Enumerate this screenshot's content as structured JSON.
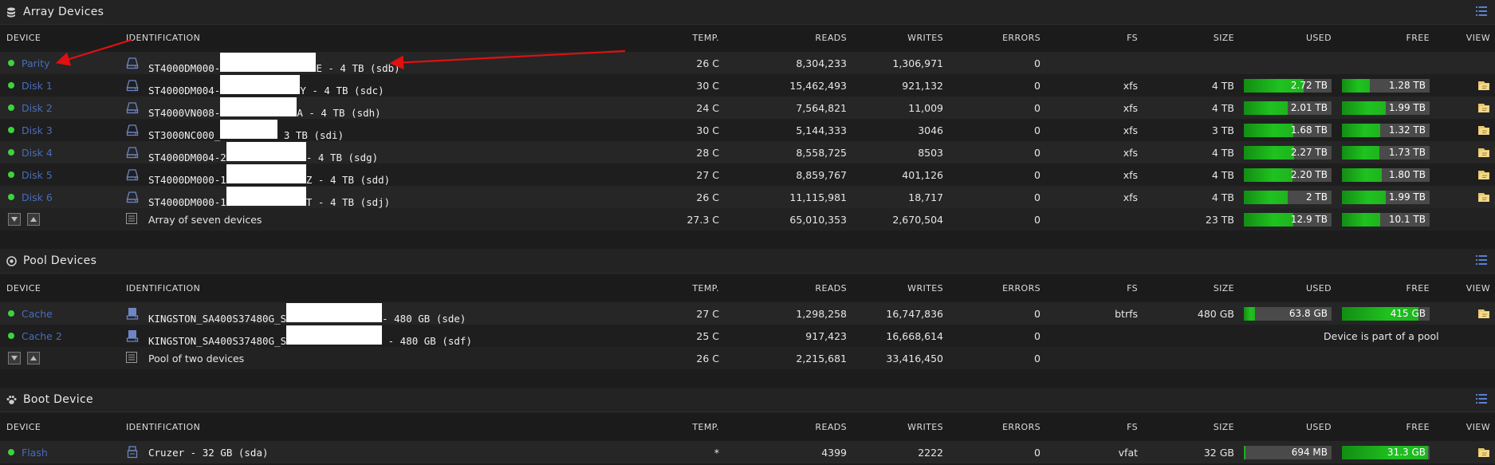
{
  "columns": {
    "device": "DEVICE",
    "identification": "IDENTIFICATION",
    "temp": "TEMP.",
    "reads": "READS",
    "writes": "WRITES",
    "errors": "ERRORS",
    "fs": "FS",
    "size": "SIZE",
    "used": "USED",
    "free": "FREE",
    "view": "VIEW"
  },
  "colors": {
    "status_ok": "#3cd33c",
    "device_link": "#486dba",
    "bar_fill": "#1fc21f",
    "bar_bg": "#4a4a4a",
    "annotation_arrow": "#e01010"
  },
  "sections": {
    "array": {
      "title": "Array Devices",
      "icon": "database-icon",
      "rows": [
        {
          "device": "Parity",
          "id_pre": "ST4000DM000-",
          "id_post": "E - 4 TB (sdb)",
          "temp": "26 C",
          "reads": "8,304,233",
          "writes": "1,306,971",
          "errors": "0",
          "fs": "",
          "size": "",
          "used": "",
          "free": "",
          "used_frac": 0,
          "free_frac": 0
        },
        {
          "device": "Disk 1",
          "id_pre": "ST4000DM004-",
          "id_post": "Y - 4 TB (sdc)",
          "temp": "30 C",
          "reads": "15,462,493",
          "writes": "921,132",
          "errors": "0",
          "fs": "xfs",
          "size": "4 TB",
          "used": "2.72 TB",
          "free": "1.28 TB",
          "used_frac": 0.68,
          "free_frac": 0.32
        },
        {
          "device": "Disk 2",
          "id_pre": "ST4000VN008-",
          "id_post": "A - 4 TB (sdh)",
          "temp": "24 C",
          "reads": "7,564,821",
          "writes": "11,009",
          "errors": "0",
          "fs": "xfs",
          "size": "4 TB",
          "used": "2.01 TB",
          "free": "1.99 TB",
          "used_frac": 0.5,
          "free_frac": 0.5
        },
        {
          "device": "Disk 3",
          "id_pre": "ST3000NC000_",
          "id_post": " 3 TB (sdi)",
          "temp": "30 C",
          "reads": "5,144,333",
          "writes": "3046",
          "errors": "0",
          "fs": "xfs",
          "size": "3 TB",
          "used": "1.68 TB",
          "free": "1.32 TB",
          "used_frac": 0.56,
          "free_frac": 0.44
        },
        {
          "device": "Disk 4",
          "id_pre": "ST4000DM004-2",
          "id_post": "- 4 TB (sdg)",
          "temp": "28 C",
          "reads": "8,558,725",
          "writes": "8503",
          "errors": "0",
          "fs": "xfs",
          "size": "4 TB",
          "used": "2.27 TB",
          "free": "1.73 TB",
          "used_frac": 0.57,
          "free_frac": 0.43
        },
        {
          "device": "Disk 5",
          "id_pre": "ST4000DM000-1",
          "id_post": "Z - 4 TB (sdd)",
          "temp": "27 C",
          "reads": "8,859,767",
          "writes": "401,126",
          "errors": "0",
          "fs": "xfs",
          "size": "4 TB",
          "used": "2.20 TB",
          "free": "1.80 TB",
          "used_frac": 0.55,
          "free_frac": 0.45
        },
        {
          "device": "Disk 6",
          "id_pre": "ST4000DM000-1",
          "id_post": "T - 4 TB (sdj)",
          "temp": "26 C",
          "reads": "11,115,981",
          "writes": "18,717",
          "errors": "0",
          "fs": "xfs",
          "size": "4 TB",
          "used": "2 TB",
          "free": "1.99 TB",
          "used_frac": 0.5,
          "free_frac": 0.5
        }
      ],
      "total": {
        "label": "Array of seven devices",
        "temp": "27.3 C",
        "reads": "65,010,353",
        "writes": "2,670,504",
        "errors": "0",
        "size": "23 TB",
        "used": "12.9 TB",
        "free": "10.1 TB",
        "used_frac": 0.56,
        "free_frac": 0.44
      }
    },
    "pool": {
      "title": "Pool Devices",
      "icon": "disc-icon",
      "rows": [
        {
          "device": "Cache",
          "id_pre": "KINGSTON_SA400S37480G_S",
          "id_post": "- 480 GB (sde)",
          "temp": "27 C",
          "reads": "1,298,258",
          "writes": "16,747,836",
          "errors": "0",
          "fs": "btrfs",
          "size": "480 GB",
          "used": "63.8 GB",
          "free": "415 GB",
          "used_frac": 0.13,
          "free_frac": 0.87
        },
        {
          "device": "Cache 2",
          "id_pre": "KINGSTON_SA400S37480G_S",
          "id_post": " - 480 GB (sdf)",
          "temp": "25 C",
          "reads": "917,423",
          "writes": "16,668,614",
          "errors": "0",
          "note": "Device is part of a pool"
        }
      ],
      "total": {
        "label": "Pool of two devices",
        "temp": "26 C",
        "reads": "2,215,681",
        "writes": "33,416,450",
        "errors": "0"
      }
    },
    "boot": {
      "title": "Boot Device",
      "icon": "paw-icon",
      "rows": [
        {
          "device": "Flash",
          "id_pre": "Cruzer - 32 GB (sda)",
          "id_post": "",
          "temp": "*",
          "reads": "4399",
          "writes": "2222",
          "errors": "0",
          "fs": "vfat",
          "size": "32 GB",
          "used": "694 MB",
          "free": "31.3 GB",
          "used_frac": 0.02,
          "free_frac": 0.98
        }
      ]
    }
  }
}
